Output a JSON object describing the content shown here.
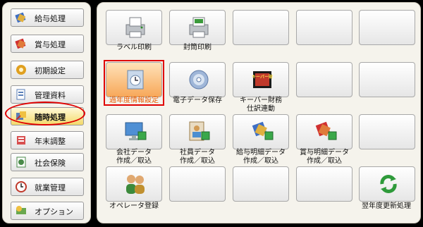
{
  "sidebar": {
    "items": [
      {
        "label": "給与処理",
        "icon": "salary-icon"
      },
      {
        "label": "賞与処理",
        "icon": "bonus-icon"
      },
      {
        "label": "初期設定",
        "icon": "initial-settings-icon"
      },
      {
        "label": "管理資料",
        "icon": "management-docs-icon"
      },
      {
        "label": "随時処理",
        "icon": "adhoc-processing-icon"
      },
      {
        "label": "年末調整",
        "icon": "year-end-adjustment-icon"
      },
      {
        "label": "社会保険",
        "icon": "social-insurance-icon"
      },
      {
        "label": "就業管理",
        "icon": "attendance-clock-icon"
      },
      {
        "label": "オプション",
        "icon": "options-icon"
      }
    ],
    "active_index": 4
  },
  "grid": {
    "row1": {
      "label1": "ラベル印刷",
      "label2": "封筒印刷"
    },
    "row2": {
      "label1": "過年度情報設定",
      "label2": "電子データ保存",
      "label3a": "キーバー財務",
      "label3b": "仕訳連動",
      "badge": "キーバー財"
    },
    "row3": {
      "l1a": "会社データ",
      "l1b": "作成／取込",
      "l2a": "社員データ",
      "l2b": "作成／取込",
      "l3a": "給与明細データ",
      "l3b": "作成／取込",
      "l4a": "賞与明細データ",
      "l4b": "作成／取込"
    },
    "row4": {
      "label1": "オペレータ登録",
      "label5": "翌年度更新処理"
    }
  },
  "colors": {
    "accent": "#e85a00",
    "highlight": "#e00000"
  }
}
